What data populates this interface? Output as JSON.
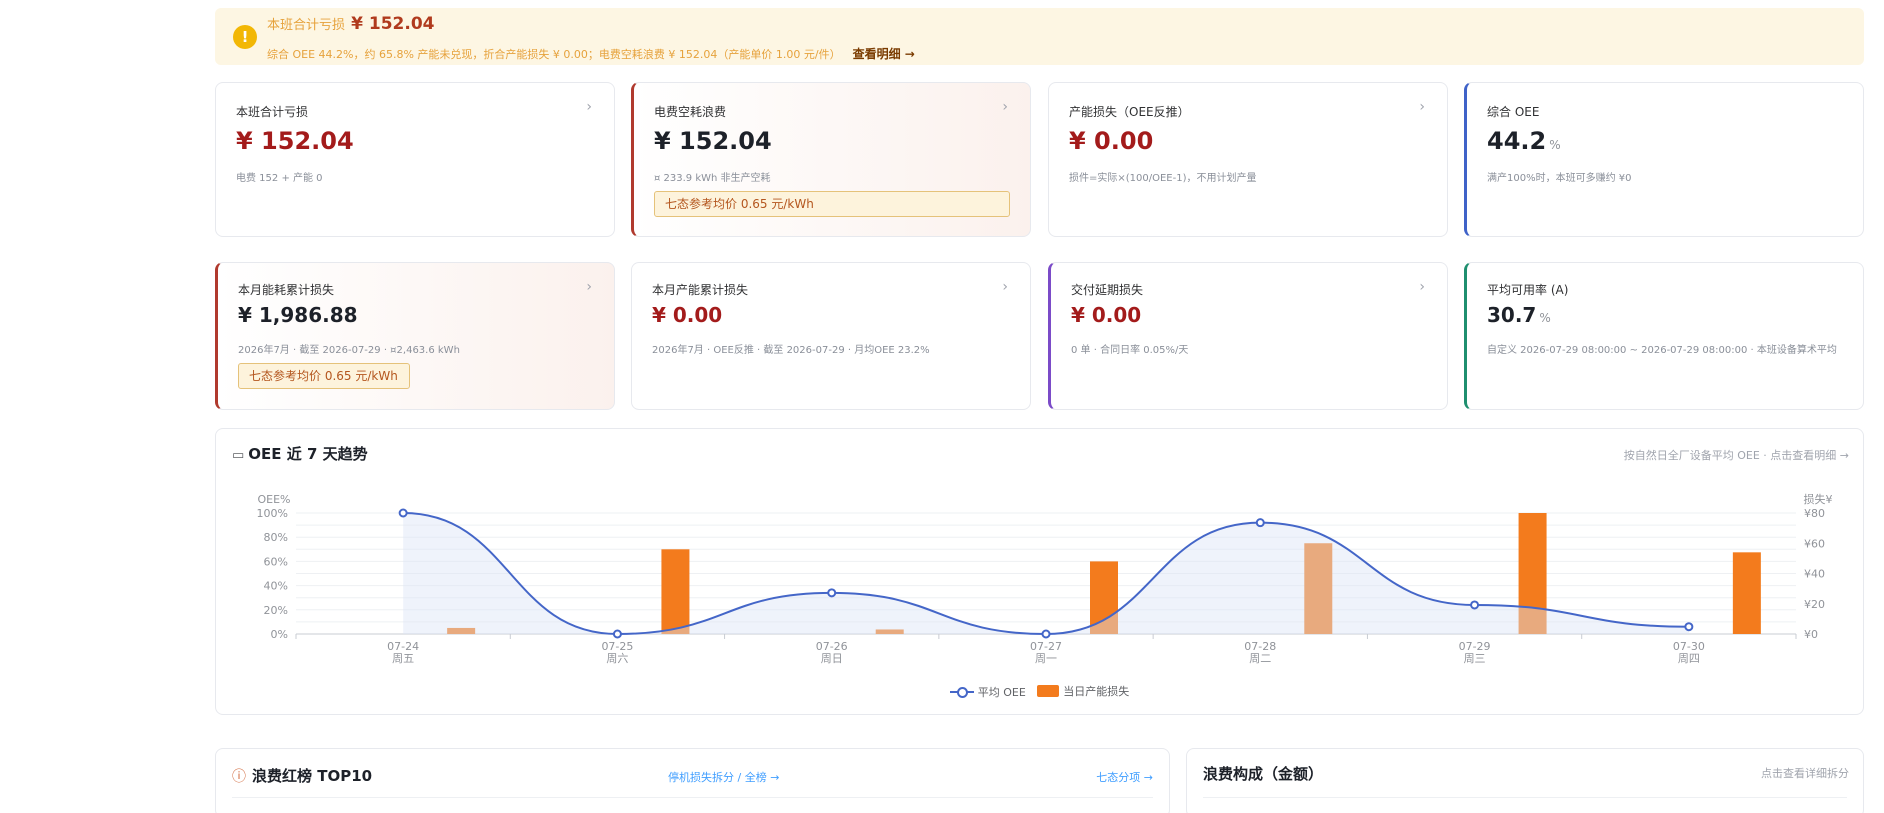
{
  "alert": {
    "title": "本班合计亏损",
    "amount": "¥ 152.04",
    "description": "综合 OEE 44.2%，约 65.8% 产能未兑现，折合产能损失 ¥ 0.00；电费空耗浪费 ¥ 152.04（产能单价 1.00 元/件）",
    "link": "查看明细 →"
  },
  "cards_row1": [
    {
      "label": "本班合计亏损",
      "value": "¥ 152.04",
      "sub": "电费 152 + 产能 0"
    },
    {
      "label": "电费空耗浪费",
      "value": "¥ 152.04",
      "sub": "¤ 233.9 kWh 非生产空耗",
      "tag": "七态参考均价 0.65 元/kWh"
    },
    {
      "label": "产能损失（OEE反推）",
      "value": "¥ 0.00",
      "sub": "损件=实际×(100/OEE-1)，不用计划产量"
    },
    {
      "label": "综合 OEE",
      "value": "44.2",
      "unit": "%",
      "sub": "满产100%时，本班可多赚约 ¥0"
    }
  ],
  "cards_row2": [
    {
      "label": "本月能耗累计损失",
      "value": "¥ 1,986.88",
      "sub": "2026年7月 · 截至 2026-07-29 · ¤2,463.6 kWh",
      "tag": "七态参考均价 0.65 元/kWh"
    },
    {
      "label": "本月产能累计损失",
      "value": "¥ 0.00",
      "sub": "2026年7月 · OEE反推 · 截至 2026-07-29 · 月均OEE 23.2%"
    },
    {
      "label": "交付延期损失",
      "value": "¥ 0.00",
      "sub": "0 单 · 合同日率 0.05%/天"
    },
    {
      "label": "平均可用率 (A)",
      "value": "30.7",
      "unit": "%",
      "sub": "自定义 2026-07-29 08:00:00 ~ 2026-07-29 08:00:00 · 本班设备算术平均"
    }
  ],
  "trend": {
    "title": "OEE 近 7 天趋势",
    "link": "按自然日全厂设备平均 OEE · 点击查看明细 →"
  },
  "chart_data": {
    "type": "bar+line",
    "categories": [
      "07-24",
      "07-25",
      "07-26",
      "07-27",
      "07-28",
      "07-29",
      "07-30"
    ],
    "weekdays": [
      "周五",
      "周六",
      "周日",
      "周一",
      "周二",
      "周三",
      "周四"
    ],
    "y_left": {
      "label": "OEE%",
      "ticks": [
        "100%",
        "80%",
        "60%",
        "40%",
        "20%",
        "0%"
      ],
      "range": [
        0,
        100
      ]
    },
    "y_right": {
      "label": "损失¥",
      "ticks": [
        "¥80",
        "¥60",
        "¥40",
        "¥20",
        "¥0"
      ],
      "range": [
        0,
        80
      ]
    },
    "series": [
      {
        "name": "平均 OEE",
        "kind": "line",
        "axis": "left",
        "values": [
          100,
          0,
          34,
          0,
          92,
          24,
          6
        ]
      },
      {
        "name": "当日产能损失",
        "kind": "bar",
        "axis": "right",
        "values": [
          4,
          56,
          3,
          48,
          60,
          80,
          54
        ]
      }
    ],
    "grid": true,
    "legend_position": "bottom",
    "colors": {
      "line": "#4466c8",
      "bar": "#f37b1d"
    }
  },
  "bottom": {
    "left_title": "浪费红榜 TOP10",
    "left_link1": "停机损失拆分 / 全榜 →",
    "left_link2": "七态分项 →",
    "right_title": "浪费构成（金额）",
    "right_link": "点击查看详细拆分"
  }
}
